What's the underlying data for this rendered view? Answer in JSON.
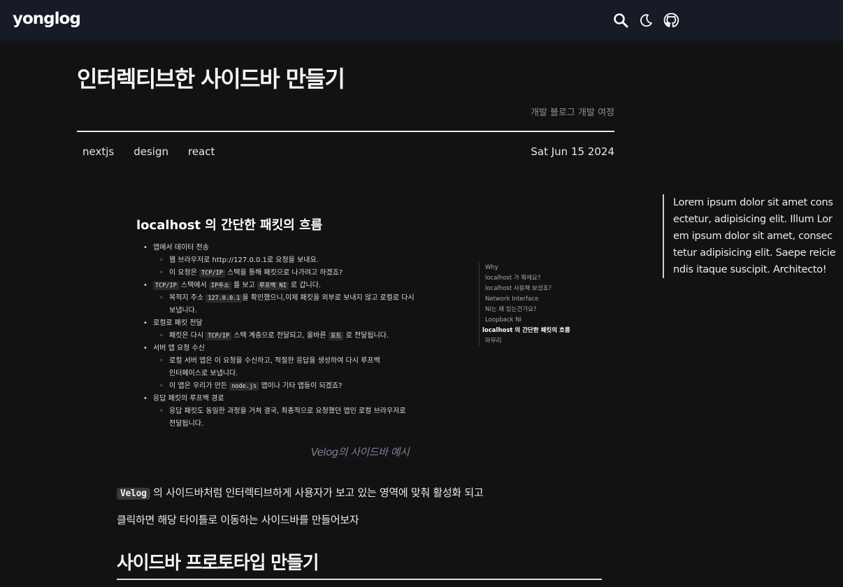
{
  "header": {
    "logo": "yonglog",
    "icons": [
      "search-icon",
      "moon-icon",
      "github-icon"
    ]
  },
  "post": {
    "title": "인터렉티브한 사이드바 만들기",
    "series": "개발 블로그 개발 여정",
    "tags": [
      "nextjs",
      "design",
      "react"
    ],
    "date": "Sat Jun 15 2024"
  },
  "screenshot": {
    "heading": "localhost 의 간단한 패킷의 흐름",
    "list": {
      "i1": "앱에서 데이터 전송",
      "i1a": "웹 브라우저로 http://127.0.0.1로 요청을 보내요.",
      "i1b_pre": "이 요청은 ",
      "i1b_code": "TCP/IP",
      "i1b_post": " 스택을 통해 패킷으로 나가려고 하겠죠?",
      "i2_code1": "TCP/IP",
      "i2_mid1": " 스택에서 ",
      "i2_code2": "IP주소",
      "i2_mid2": " 를 보고 ",
      "i2_code3": "루프백 NI",
      "i2_post": " 로 갑니다.",
      "i2a_pre": "목적지 주소 ",
      "i2a_code": "127.0.0.1",
      "i2a_post": "을 확인했으니,이제 패킷을 외부로 보내지 않고 로컬로 다시",
      "i2a_cont": "보냅니다.",
      "i3": "로컬로 패킷 전달",
      "i3a_pre": "패킷은 다시 ",
      "i3a_code": "TCP/IP",
      "i3a_mid": " 스택 계층으로 전달되고, 올바른 ",
      "i3a_code2": "포트",
      "i3a_post": " 로 전달됩니다.",
      "i4": "서버 앱 요청 수신",
      "i4a": "로컬 서버 앱은 이 요청을 수신하고, 적절한 응답을 생성하여 다시 루프백",
      "i4a_cont": "인터페이스로 보냅니다.",
      "i4b_pre": "이 앱은 우리가 만든 ",
      "i4b_code": "node.js",
      "i4b_post": " 앱이나 기타 앱들이 되겠죠?",
      "i5": "응답 패킷의 루프백 경로",
      "i5a": "응답 패킷도 동일한 과정을 거쳐 결국, 최종적으로 요청했던 앱인 로컬 브라우저로",
      "i5a_cont": "전달됩니다."
    },
    "toc": [
      "Why",
      "localhost 가 뭐에요?",
      "localhost 사용해 보셨죠?",
      "Network Interface",
      "NI는 왜 있는건가요?",
      "Loopback NI",
      "localhost 의 간단한 패킷의 흐름",
      "마무리"
    ],
    "toc_active_index": 6
  },
  "caption": "Velog의 사이드바 예시",
  "body": {
    "para1_code": "Velog",
    "para1_text": " 의 사이드바처럼 인터렉티브하게 사용자가 보고 있는 영역에 맞춰 활성화 되고",
    "para2": "클릭하면 해당 타이틀로 이동하는 사이드바를 만들어보자",
    "h2": "사이드바 프로토타입 만들기"
  },
  "aside": {
    "text": "Lorem ipsum dolor sit amet consectetur, adipisicing elit. Illum Lorem ipsum dolor sit amet, consectetur adipisicing elit. Saepe reiciendis itaque suscipit. Architecto!"
  },
  "colors": {
    "background": "#121212",
    "header": "#161b26",
    "muted": "#8a90a0"
  }
}
